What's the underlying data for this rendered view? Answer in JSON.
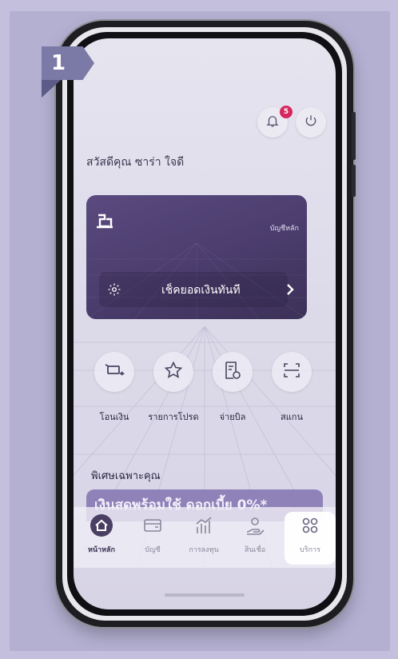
{
  "step": {
    "number": "1"
  },
  "header": {
    "notification_count": "5",
    "greeting": "สวัสดีคุณ ซาร่า ใจดี"
  },
  "account_card": {
    "type_label": "บัญชีหลัก",
    "balance_button_label": "เช็คยอดเงินทันที"
  },
  "quick_menu": [
    {
      "label": "โอนเงิน",
      "icon": "transfer-icon"
    },
    {
      "label": "รายการโปรด",
      "icon": "star-icon"
    },
    {
      "label": "จ่ายบิล",
      "icon": "bill-icon"
    },
    {
      "label": "สแกน",
      "icon": "scan-icon"
    }
  ],
  "section": {
    "title": "พิเศษเฉพาะคุณ"
  },
  "promo": {
    "text": "เงินสดพร้อมใช้ ดอกเบี้ย 0%*"
  },
  "bottom_nav": [
    {
      "label": "หน้าหลัก",
      "icon": "home-icon",
      "active": true
    },
    {
      "label": "บัญชี",
      "icon": "wallet-icon",
      "active": false
    },
    {
      "label": "การลงทุน",
      "icon": "investment-icon",
      "active": false
    },
    {
      "label": "สินเชื่อ",
      "icon": "loan-icon",
      "active": false
    },
    {
      "label": "บริการ",
      "icon": "services-icon",
      "active": false
    }
  ],
  "colors": {
    "background": "#c3bfdc",
    "accent_purple": "#4a3c6c",
    "badge_red": "#d6285e",
    "step_badge": "#7b7aa6"
  }
}
